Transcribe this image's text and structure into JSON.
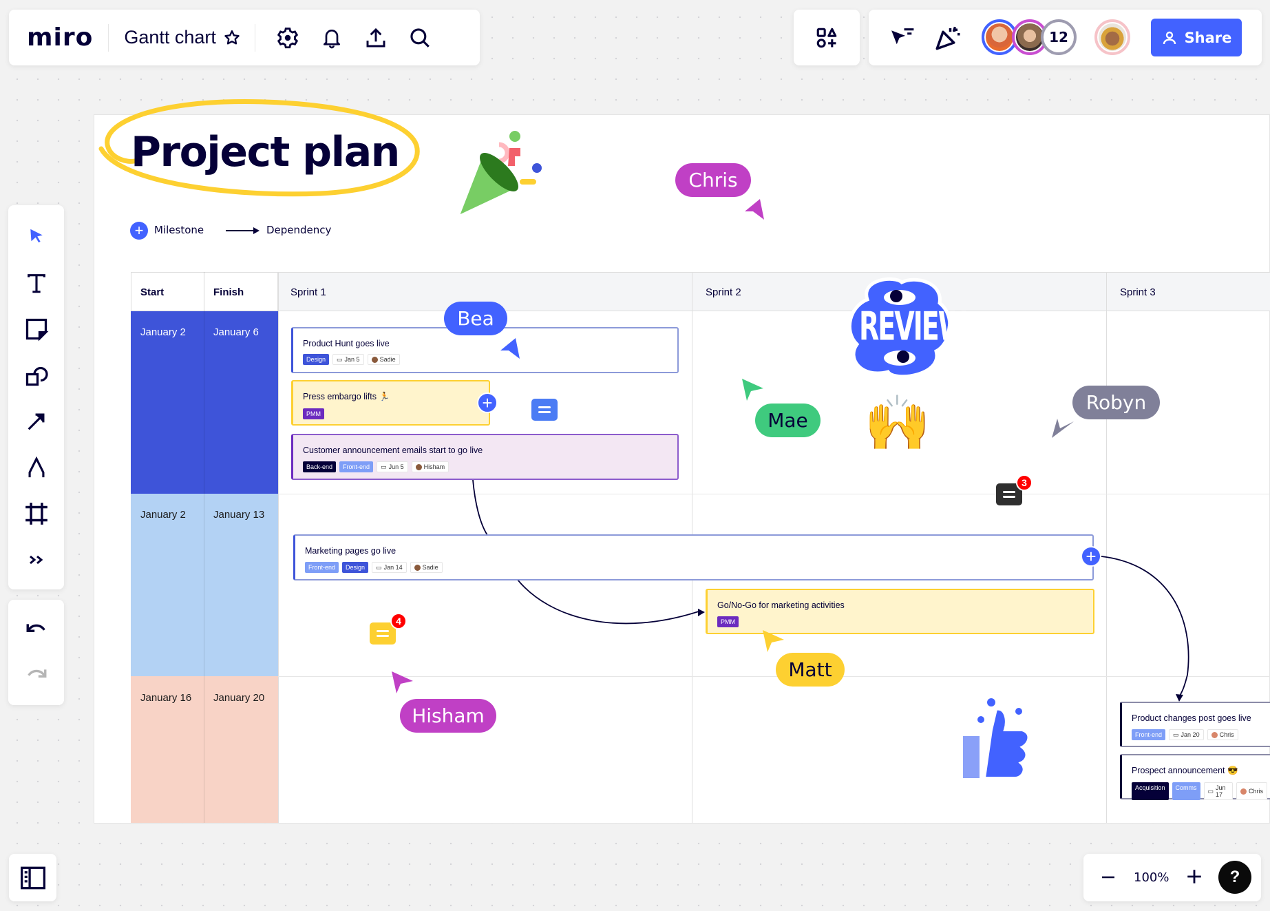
{
  "app": {
    "logo": "miro",
    "board_title": "Gantt chart",
    "collaborator_count": "12",
    "share_label": "Share",
    "zoom_level": "100%",
    "help_label": "?"
  },
  "colors": {
    "accent": "#4262ff",
    "row1": "#3e54d9",
    "row2": "#b3d2f4",
    "row3": "#f8d3c6"
  },
  "toolbar": {
    "items": [
      "select",
      "text",
      "sticky-note",
      "shapes",
      "arrow",
      "pen",
      "frame",
      "more"
    ]
  },
  "board": {
    "title": "Project plan",
    "legend": {
      "milestone": "Milestone",
      "dependency": "Dependency"
    },
    "columns": {
      "start": "Start",
      "finish": "Finish",
      "sprints": [
        "Sprint 1",
        "Sprint 2",
        "Sprint 3"
      ]
    },
    "rows": [
      {
        "start": "January 2",
        "finish": "January 6"
      },
      {
        "start": "January 2",
        "finish": "January 13"
      },
      {
        "start": "January 16",
        "finish": "January 20"
      }
    ],
    "tasks": [
      {
        "title": "Product Hunt goes live",
        "tags": [
          "Design"
        ],
        "date": "Jan 5",
        "owner": "Sadie"
      },
      {
        "title": "Press embargo lifts 🏃",
        "tags": [
          "PMM"
        ]
      },
      {
        "title": "Customer announcement emails start to go live",
        "tags": [
          "Back-end",
          "Front-end"
        ],
        "date": "Jun 5",
        "owner": "Hisham"
      },
      {
        "title": "Marketing pages go live",
        "tags": [
          "Front-end",
          "Design"
        ],
        "date": "Jan 14",
        "owner": "Sadie"
      },
      {
        "title": "Go/No-Go for marketing activities",
        "tags": [
          "PMM"
        ]
      },
      {
        "title": "Product changes post goes live",
        "tags": [
          "Front-end"
        ],
        "date": "Jan 20",
        "owner": "Chris"
      },
      {
        "title": "Prospect announcement 😎",
        "tags": [
          "Acquisition",
          "Comms"
        ],
        "date": "Jun 17",
        "owner": "Chris"
      }
    ],
    "cursors": [
      "Chris",
      "Bea",
      "Mae",
      "Robyn",
      "Matt",
      "Hisham"
    ],
    "comments": [
      {
        "count": "3"
      },
      {
        "count": "4"
      }
    ],
    "stickers": {
      "review": "REVIEW",
      "hands": "🙌"
    }
  }
}
